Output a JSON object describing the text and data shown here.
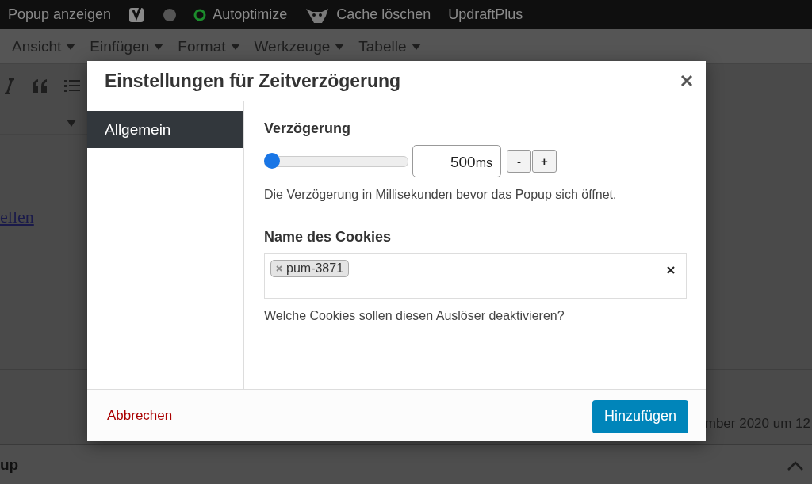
{
  "admin_bar": {
    "items": [
      {
        "kind": "text",
        "label": "Popup anzeigen"
      },
      {
        "kind": "yoast"
      },
      {
        "kind": "dot"
      },
      {
        "kind": "ring",
        "label": "Autoptimize"
      },
      {
        "kind": "beast",
        "label": "Cache löschen"
      },
      {
        "kind": "text",
        "label": "UpdraftPlus"
      }
    ]
  },
  "menu_bar": {
    "items": [
      "Ansicht",
      "Einfügen",
      "Format",
      "Werkzeuge",
      "Tabelle"
    ]
  },
  "editor": {
    "link_text": "ellen",
    "date_text": "mber 2020 um 12",
    "box_title": "up"
  },
  "dialog": {
    "title": "Einstellungen für Zeitverzögerung",
    "tabs": [
      {
        "label": "Allgemein",
        "selected": true
      }
    ],
    "delay": {
      "label": "Verzögerung",
      "level": 0.05,
      "value": "500",
      "unit": "ms",
      "minus": "-",
      "plus": "+",
      "description": "Die Verzögerung in Millisekunden bevor das Popup sich öffnet."
    },
    "cookie": {
      "label": "Name des Cookies",
      "tags": [
        "pum-3871"
      ],
      "description": "Welche Cookies sollen diesen Auslöser deaktivieren?"
    },
    "cancel": "Abbrechen",
    "submit": "Hinzufügen"
  }
}
